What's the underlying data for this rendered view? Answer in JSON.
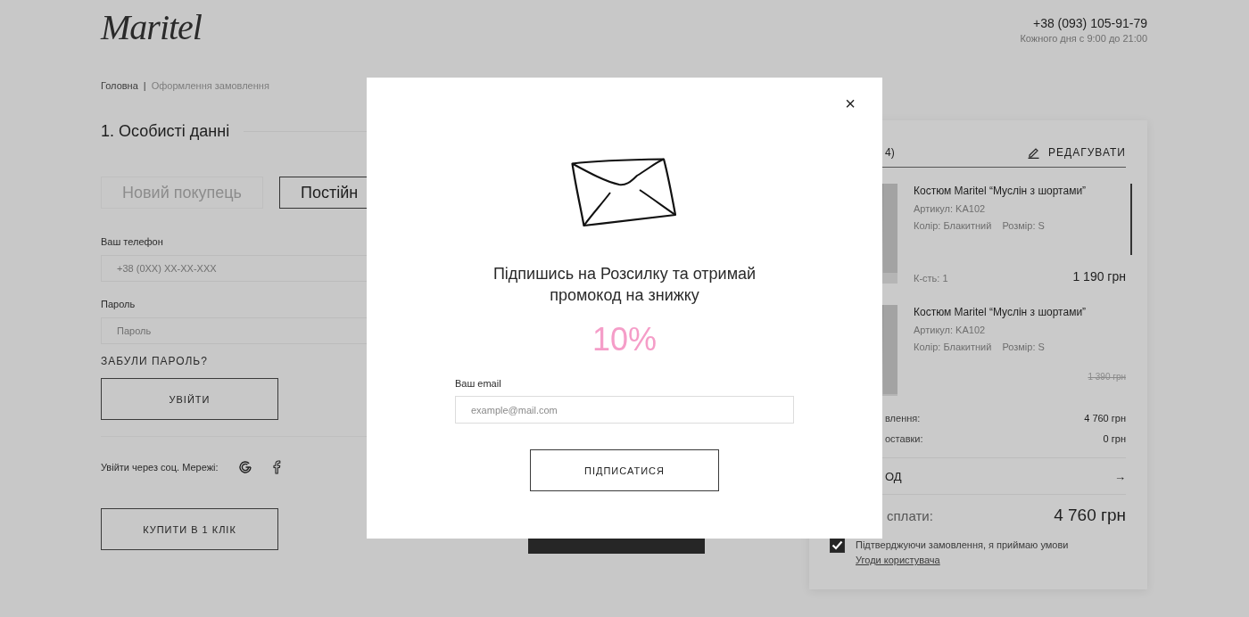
{
  "logo": "Maritel",
  "contact": {
    "phone": "+38 (093) 105-91-79",
    "hours": "Кожного дня с 9:00 до 21:00"
  },
  "breadcrumb": [
    {
      "label": "Головна"
    },
    {
      "label": "Оформлення замовлення"
    }
  ],
  "breadcrumb_separator": "|",
  "section_title": "1. Особисті данні",
  "tabs": [
    {
      "label": "Новий покупець",
      "selected": false
    },
    {
      "label": "Постійн",
      "selected": true
    }
  ],
  "fields": [
    {
      "label": "Ваш телефон",
      "placeholder": "+38 (0XX) XX-XX-XXX"
    },
    {
      "label": "Пароль",
      "placeholder": "Пароль"
    }
  ],
  "forgot_link": "ЗАБУЛИ ПАРОЛЬ?",
  "login_button": "УВІЙТИ",
  "social": {
    "label": "Увійти через соц. Мережі:"
  },
  "one_click_button": "КУПИТИ В 1 КЛІК",
  "cart": {
    "count": "4)",
    "edit": "РЕДАГУВАТИ",
    "items": [
      {
        "title": "Костюм Maritel “Муслін з шортами”",
        "article": "Артикул: KA102",
        "variant": "Колір: Блакитний",
        "size": "Розмір: S",
        "qty": "К-сть: 1",
        "price": "1 190 грн"
      },
      {
        "title": "Костюм Maritel “Муслін з шортами”",
        "article": "Артикул: KA102",
        "variant": "Колір: Блакитний",
        "size": "Розмір: S",
        "old_price": "1 390 грн"
      }
    ],
    "summary": [
      {
        "label": "влення:",
        "value": "4 760 грн"
      },
      {
        "label": "оставки:",
        "value": "0 грн"
      }
    ],
    "promo": "ОД",
    "promo_arrow": "→",
    "total_label": "сплати:",
    "total": "4 760 грн",
    "agree": {
      "checked": true,
      "text": "Підтверджуючи замовлення, я приймаю умови",
      "link": "Угоди користувача"
    }
  },
  "modal": {
    "close": "×",
    "title": "Підпишись на Розсилку та отримай промокод на знижку",
    "discount": "10%",
    "email_label": "Ваш email",
    "email_placeholder": "example@mail.com",
    "button": "ПІДПИСАТИСЯ"
  }
}
